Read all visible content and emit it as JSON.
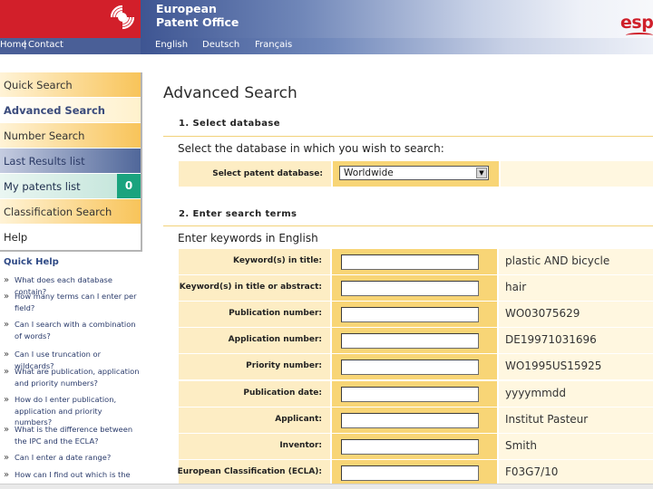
{
  "header": {
    "office_name_line1": "European",
    "office_name_line2": "Patent Office",
    "espacenet_logo_text": "esp",
    "nav_home": "Home",
    "nav_separator": "|",
    "nav_contact": "Contact",
    "languages": [
      "English",
      "Deutsch",
      "Français"
    ]
  },
  "sidebar": {
    "items": [
      {
        "label": "Quick Search"
      },
      {
        "label": "Advanced Search"
      },
      {
        "label": "Number Search"
      },
      {
        "label": "Last Results list"
      },
      {
        "label": "My patents list",
        "count": "0"
      },
      {
        "label": "Classification Search"
      },
      {
        "label": "Help"
      }
    ]
  },
  "quick_help": {
    "title": "Quick Help",
    "items": [
      "What does each database contain?",
      "How many terms can I enter per field?",
      "Can I search with a combination of words?",
      "Can I use truncation or wildcards?",
      "What are publication, application and priority numbers?",
      "How do I enter publication, application and priority numbers?",
      "What is the difference between the IPC and the ECLA?",
      "Can I enter a date range?",
      "How can I find out which is the"
    ]
  },
  "main": {
    "title": "Advanced Search",
    "section1": {
      "heading": "1. Select database",
      "text": "Select the database in which you wish to search:",
      "db_label": "Select patent database:",
      "db_value": "Worldwide"
    },
    "section2": {
      "heading": "2. Enter search terms",
      "text": "Enter keywords in English",
      "rows": [
        {
          "label": "Keyword(s) in title:",
          "example": "plastic AND bicycle"
        },
        {
          "label": "Keyword(s) in title or abstract:",
          "example": "hair"
        },
        {
          "label": "Publication number:",
          "example": "WO03075629"
        },
        {
          "label": "Application number:",
          "example": "DE19971031696"
        },
        {
          "label": "Priority number:",
          "example": "WO1995US15925"
        },
        {
          "label": "Publication date:",
          "example": "yyyymmdd"
        },
        {
          "label": "Applicant:",
          "example": "Institut Pasteur"
        },
        {
          "label": "Inventor:",
          "example": "Smith"
        },
        {
          "label": "European Classification (ECLA):",
          "example": "F03G7/10"
        }
      ]
    }
  },
  "colors": {
    "epo_red": "#d21f2a",
    "nav_blue": "#3e5592",
    "label_cell": "#fdedc4",
    "input_cell": "#f8d576",
    "count_badge": "#1aa37e"
  },
  "icons": {
    "epo_logo": "epo-logo-icon",
    "dropdown": "chevron-down-icon",
    "bullet": "double-arrow-bullet-icon"
  }
}
